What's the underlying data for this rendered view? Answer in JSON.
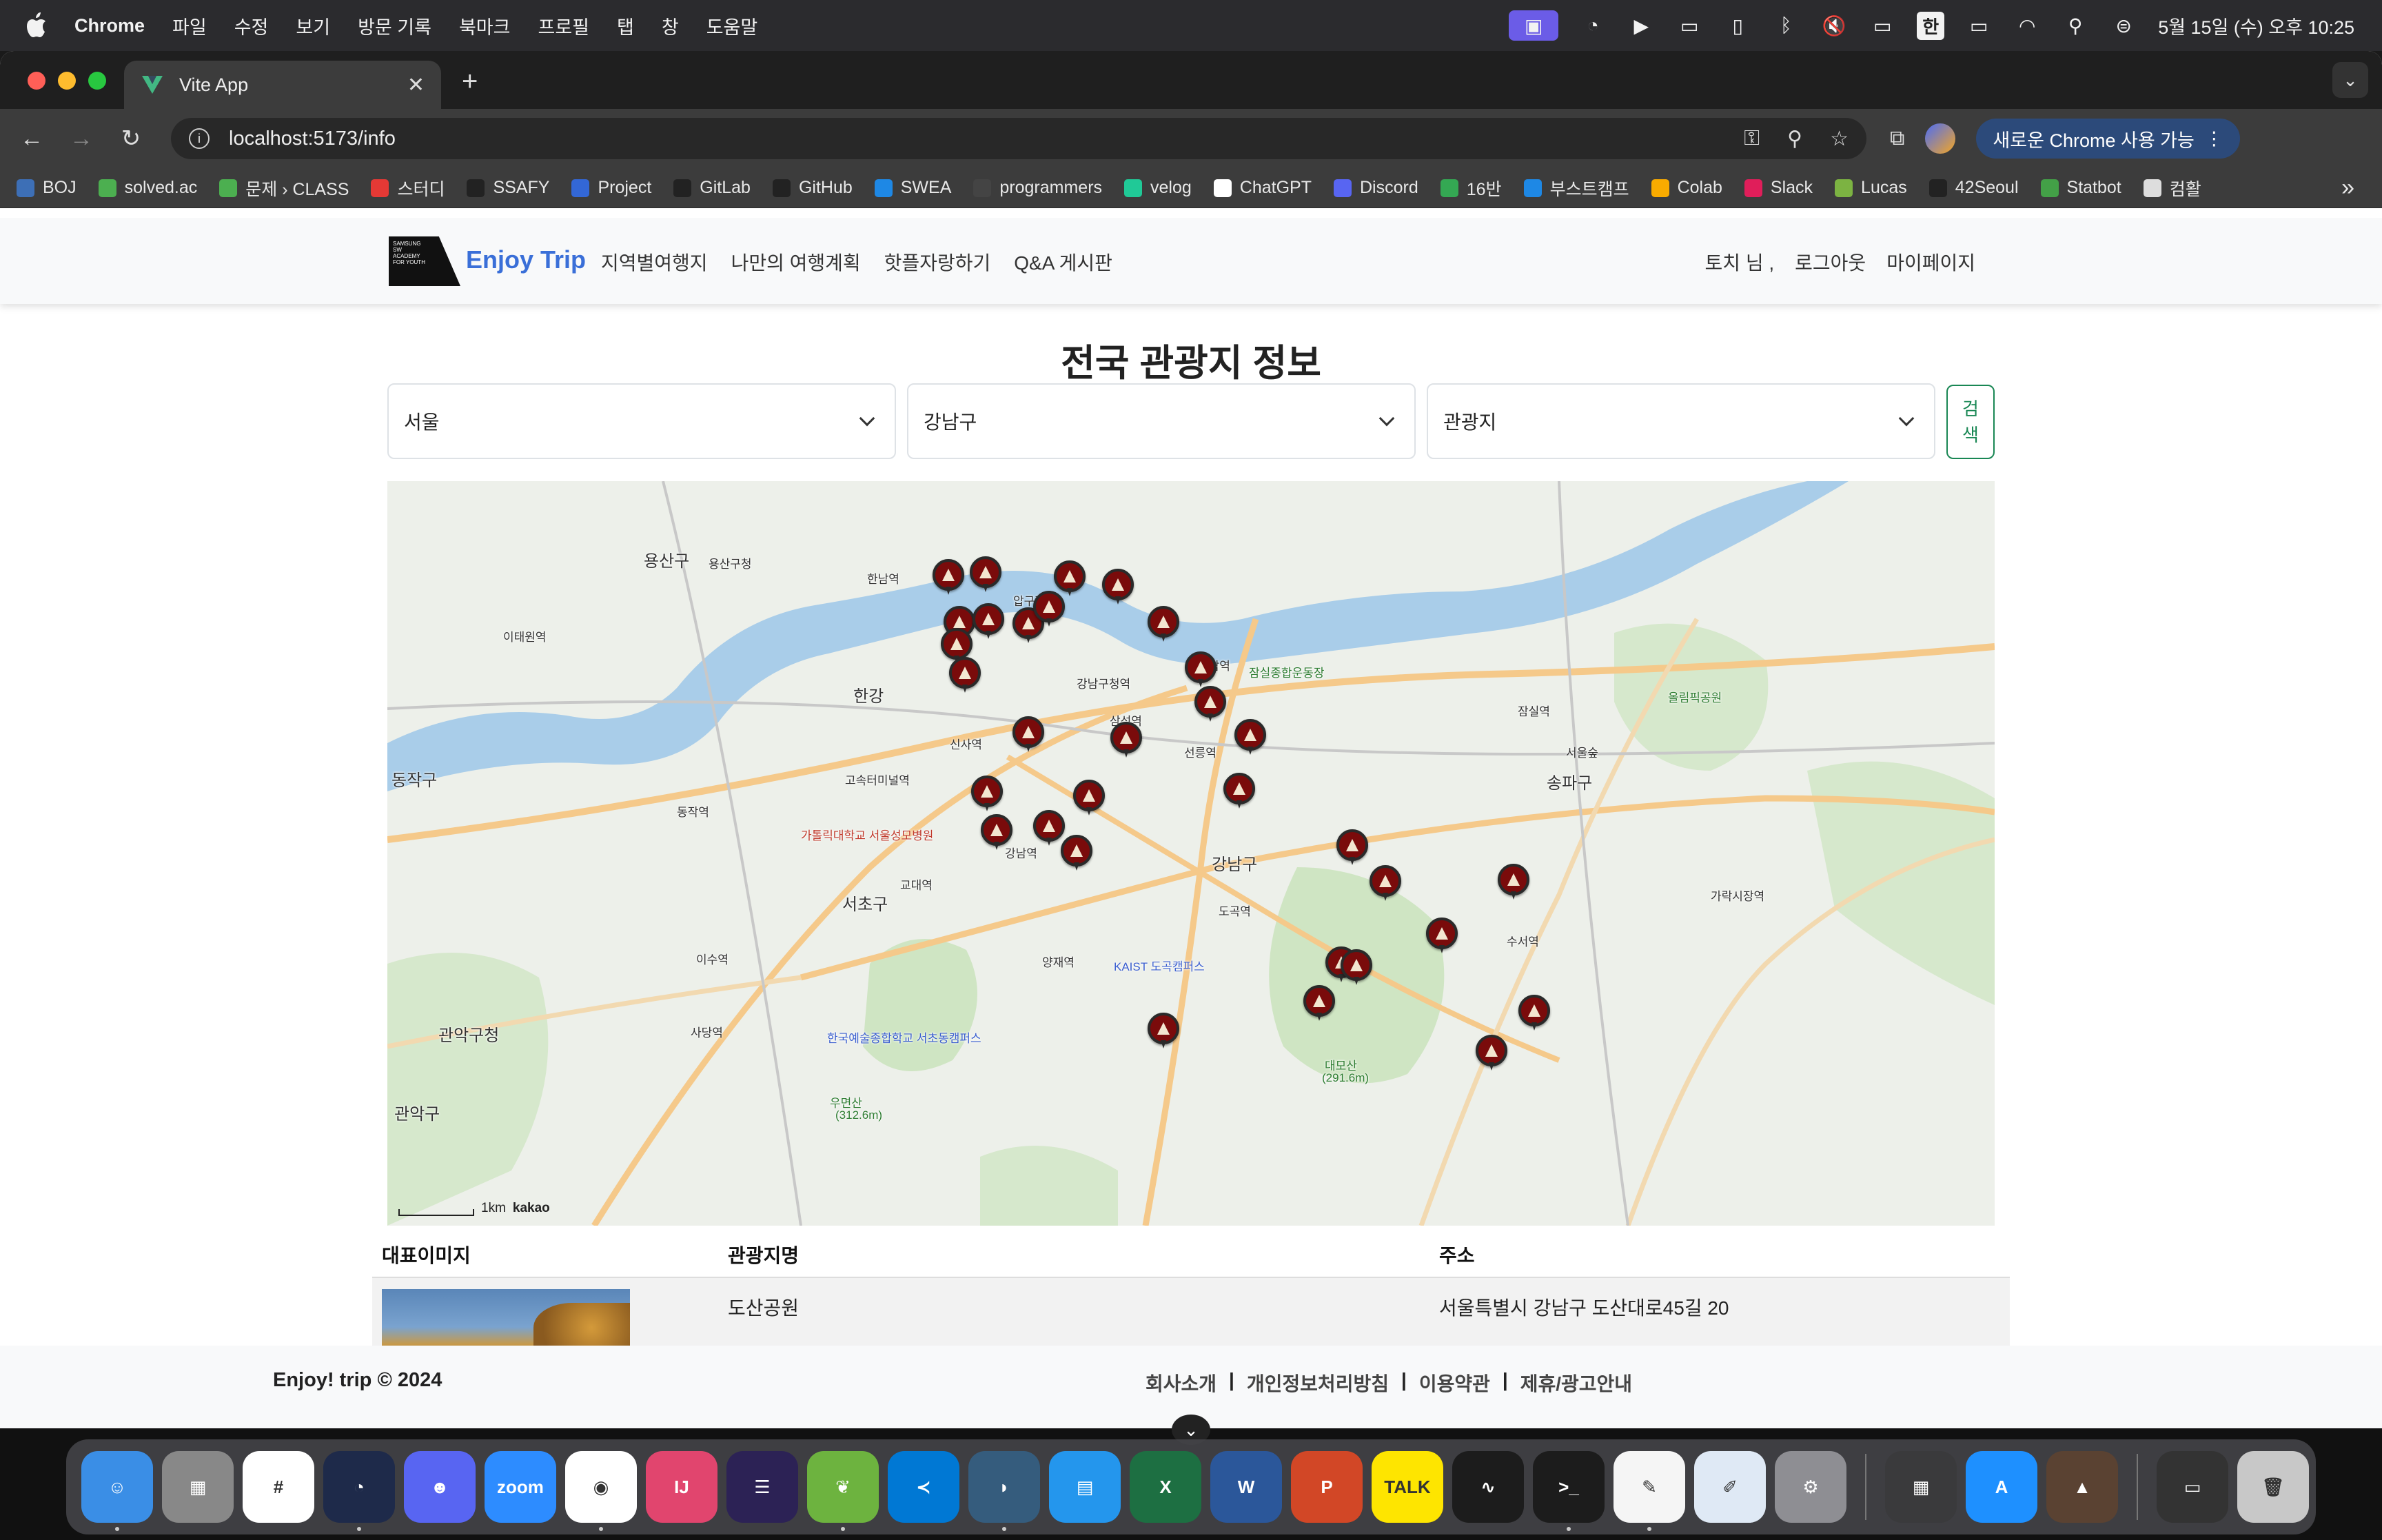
{
  "menubar": {
    "app_name": "Chrome",
    "items": [
      "파일",
      "수정",
      "보기",
      "방문 기록",
      "북마크",
      "프로필",
      "탭",
      "창",
      "도움말"
    ],
    "ime": "한",
    "datetime": "5월 15일 (수) 오후 10:25"
  },
  "browser": {
    "tab_title": "Vite App",
    "url": "localhost:5173/info",
    "update_label": "새로운 Chrome 사용 가능",
    "bookmarks": [
      "BOJ",
      "solved.ac",
      "문제 › CLASS",
      "스터디",
      "SSAFY",
      "Project",
      "GitLab",
      "GitHub",
      "SWEA",
      "programmers",
      "velog",
      "ChatGPT",
      "Discord",
      "16반",
      "부스트캠프",
      "Colab",
      "Slack",
      "Lucas",
      "42Seoul",
      "Statbot",
      "컴활"
    ],
    "bookmark_colors": [
      "#3d6fb6",
      "#4caf50",
      "#4caf50",
      "#e53935",
      "#222222",
      "#3367d6",
      "#222222",
      "#222222",
      "#1e88e5",
      "#444444",
      "#20c997",
      "#ffffff",
      "#5865f2",
      "#34a853",
      "#1e88e5",
      "#f9ab00",
      "#e01e5a",
      "#7cb342",
      "#222222",
      "#43a047",
      "#dddddd"
    ]
  },
  "site": {
    "logo_text": "SAMSUNG SW ACADEMY FOR YOUTH",
    "brand": "Enjoy Trip",
    "nav": [
      "지역별여행지",
      "나만의 여행계획",
      "핫플자랑하기",
      "Q&A 게시판"
    ],
    "user_greeting": "토치 님 ,",
    "logout": "로그아웃",
    "mypage": "마이페이지"
  },
  "content": {
    "title": "전국 관광지 정보",
    "sido_value": "서울",
    "gugun_value": "강남구",
    "type_value": "관광지",
    "search_label_1": "검",
    "search_label_2": "색"
  },
  "map": {
    "attribution": "kakao",
    "scale_label": "1km",
    "labels": {
      "river1": "한강",
      "yongsan_gu": "용산구",
      "yongsan_office": "용산구청",
      "seocho_gu": "서초구",
      "gangnam_gu": "강남구",
      "songpa_gu": "송파구",
      "gwanak_gu": "관악구",
      "gwanak_office": "관악구청",
      "dongjak_gu": "동작구",
      "seoul_forest": "서울숲",
      "sports_complex": "잠실종합운동장",
      "olympic_park": "올림픽공원",
      "yangjae": "양재역",
      "seolleung": "선릉역",
      "samseong": "삼성역",
      "gangnam_stn": "강남역",
      "kyodae": "교대역",
      "express_terminal": "고속터미널역",
      "apgujeong": "압구정",
      "cheongdam": "청담역",
      "umyeonsan": "우면산",
      "umyeonsan_h": "(312.6m)",
      "daemosan": "대모산",
      "daemosan_h": "(291.6m)",
      "seoul_arts": "한국예술종합학교 서초동캠퍼스",
      "catholic": "가톨릭대학교 서울성모병원",
      "kaist": "KAIST 도곡캠퍼스",
      "suseo": "수서역",
      "garak": "가락시장역",
      "jamsil": "잠실역",
      "itaewon": "이태원역",
      "isu": "이수역",
      "sadang": "사당역",
      "dogok": "도곡역",
      "hannam": "한남역",
      "dongjak": "동작역",
      "sinsa": "신사역",
      "gangnam_office": "강남구청역"
    }
  },
  "results": {
    "headers": [
      "대표이미지",
      "관광지명",
      "주소"
    ],
    "rows": [
      {
        "name": "도산공원",
        "address": "서울특별시 강남구 도산대로45길 20"
      }
    ]
  },
  "footer": {
    "copyright": "Enjoy! trip © 2024",
    "links": [
      "회사소개",
      "개인정보처리방침",
      "이용약관",
      "제휴/광고안내"
    ]
  },
  "dock": {
    "apps": [
      {
        "name": "Finder",
        "color": "#3a8ee6",
        "glyph": "☺"
      },
      {
        "name": "Launchpad",
        "color": "#888888",
        "glyph": "▦"
      },
      {
        "name": "Slack",
        "color": "#ffffff",
        "glyph": "#"
      },
      {
        "name": "Clockify",
        "color": "#1e2a4a",
        "glyph": "◔"
      },
      {
        "name": "Discord",
        "color": "#5865f2",
        "glyph": "☻"
      },
      {
        "name": "Zoom",
        "color": "#2d8cff",
        "glyph": "zoom"
      },
      {
        "name": "Chrome",
        "color": "#ffffff",
        "glyph": "◉"
      },
      {
        "name": "IntelliJ",
        "color": "#e1456e",
        "glyph": "IJ"
      },
      {
        "name": "Eclipse",
        "color": "#2c2255",
        "glyph": "☰"
      },
      {
        "name": "Spring",
        "color": "#6db33f",
        "glyph": "❦"
      },
      {
        "name": "VS Code",
        "color": "#0078d4",
        "glyph": "≺"
      },
      {
        "name": "MySQL Workbench",
        "color": "#355c7d",
        "glyph": "◗"
      },
      {
        "name": "Docker",
        "color": "#2496ed",
        "glyph": "▤"
      },
      {
        "name": "Excel",
        "color": "#1d6f42",
        "glyph": "X"
      },
      {
        "name": "Word",
        "color": "#2b579a",
        "glyph": "W"
      },
      {
        "name": "PowerPoint",
        "color": "#d24726",
        "glyph": "P"
      },
      {
        "name": "KakaoTalk",
        "color": "#fee500",
        "glyph": "TALK"
      },
      {
        "name": "Activity Monitor",
        "color": "#1c1c1c",
        "glyph": "∿"
      },
      {
        "name": "Terminal",
        "color": "#1c1c1c",
        "glyph": ">_"
      },
      {
        "name": "TextEdit",
        "color": "#f5f5f5",
        "glyph": "✎"
      },
      {
        "name": "Script Editor",
        "color": "#dfe9f5",
        "glyph": "✐"
      },
      {
        "name": "System Settings",
        "color": "#8e8e93",
        "glyph": "⚙"
      },
      {
        "name": "Calculator",
        "color": "#3a3a3c",
        "glyph": "▦"
      },
      {
        "name": "App Store",
        "color": "#1e90ff",
        "glyph": "A"
      },
      {
        "name": "Photo",
        "color": "#5a4232",
        "glyph": "▲"
      },
      {
        "name": "Chrome Window",
        "color": "#333333",
        "glyph": "▭"
      },
      {
        "name": "Trash",
        "color": "#c8c8c8",
        "glyph": "🗑"
      }
    ]
  }
}
